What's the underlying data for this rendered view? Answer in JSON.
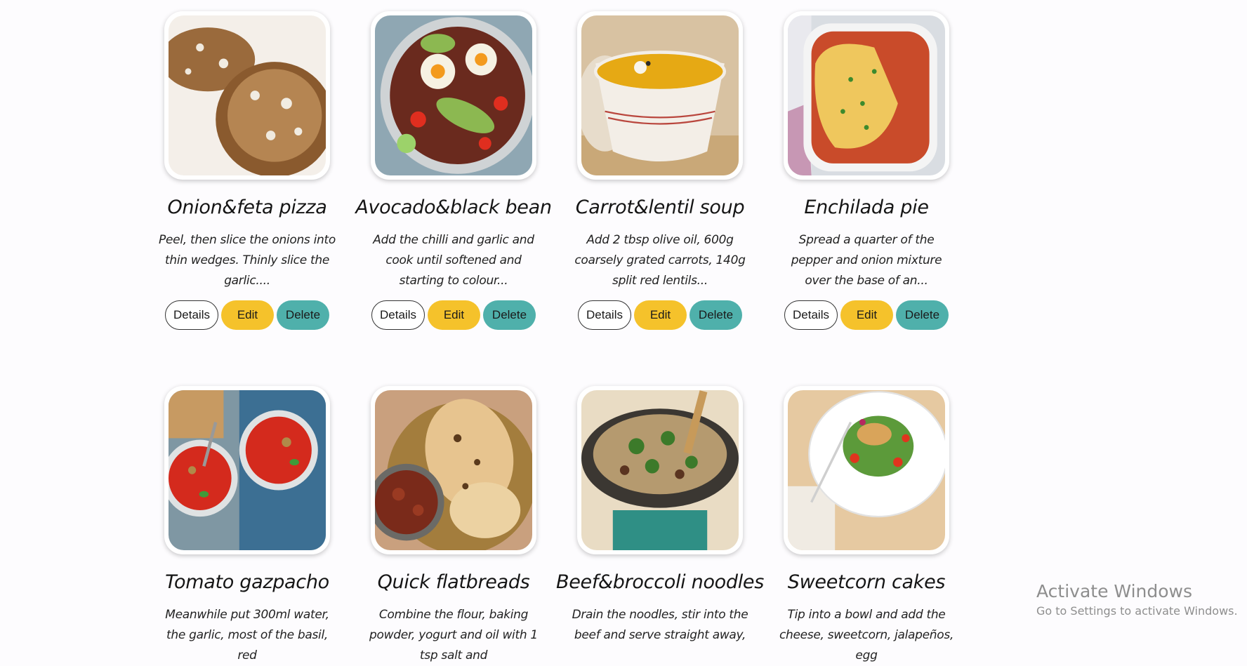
{
  "recipes": [
    {
      "title": "Onion&feta pizza",
      "description": "Peel, then slice the onions into thin wedges. Thinly slice the garlic....",
      "image": "onion-feta-pizza-photo"
    },
    {
      "title": "Avocado&black bean",
      "description": "Add the chilli and garlic and cook until softened and starting to colour...",
      "image": "avocado-black-bean-photo"
    },
    {
      "title": "Carrot&lentil soup",
      "description": "Add 2 tbsp olive oil, 600g coarsely grated carrots, 140g split red lentils...",
      "image": "carrot-lentil-soup-photo"
    },
    {
      "title": "Enchilada pie",
      "description": "Spread a quarter of the pepper and onion mixture over the base of an...",
      "image": "enchilada-pie-photo"
    },
    {
      "title": "Tomato gazpacho",
      "description": "Meanwhile put 300ml water, the garlic, most of the basil, red",
      "image": "tomato-gazpacho-photo"
    },
    {
      "title": "Quick flatbreads",
      "description": "Combine the flour, baking powder, yogurt and oil with 1 tsp salt and",
      "image": "quick-flatbreads-photo"
    },
    {
      "title": "Beef&broccoli noodles",
      "description": "Drain the noodles, stir into the beef and serve straight away,",
      "image": "beef-broccoli-noodles-photo"
    },
    {
      "title": "Sweetcorn cakes",
      "description": "Tip into a bowl and add the cheese, sweetcorn, jalapeños, egg",
      "image": "sweetcorn-cakes-photo"
    }
  ],
  "actions": {
    "details_label": "Details",
    "edit_label": "Edit",
    "delete_label": "Delete"
  },
  "watermark": {
    "title": "Activate Windows",
    "subtitle": "Go to Settings to activate Windows."
  },
  "colors": {
    "edit": "#f5c22b",
    "delete": "#4fb0ab",
    "background": "#fdfcfe"
  }
}
